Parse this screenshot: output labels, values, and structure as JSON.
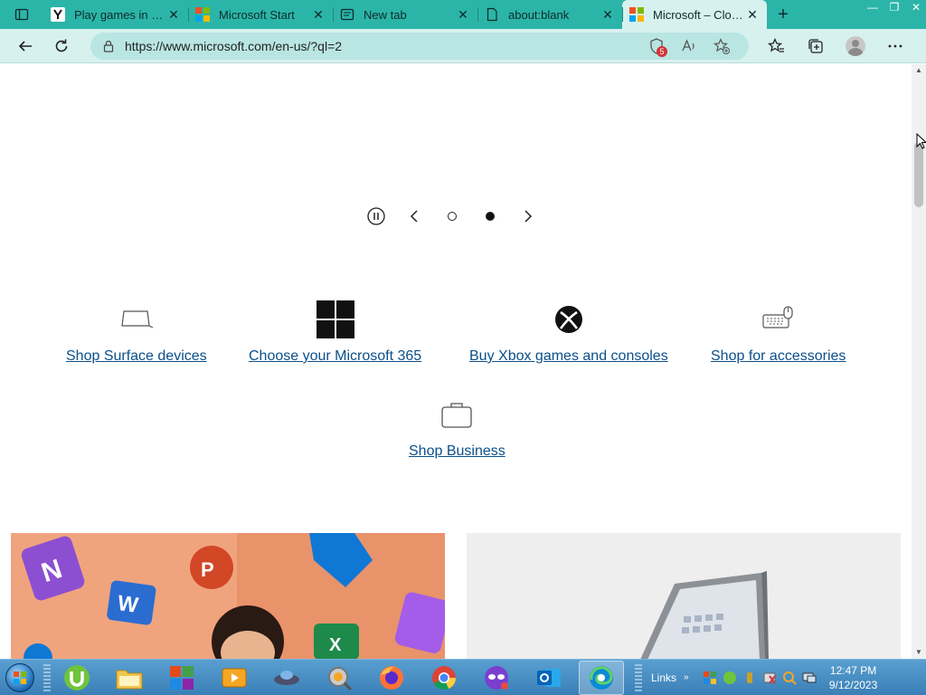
{
  "tabs": [
    {
      "title": "Play games in your browser",
      "favicon": "y-icon",
      "active": false
    },
    {
      "title": "Microsoft Start",
      "favicon": "microsoft-logo-icon",
      "active": false
    },
    {
      "title": "New tab",
      "favicon": "newtab-icon",
      "active": false
    },
    {
      "title": "about:blank",
      "favicon": "page-icon",
      "active": false
    },
    {
      "title": "Microsoft – Cloud, Computers, Apps & Gaming",
      "favicon": "microsoft-logo-icon",
      "active": true
    }
  ],
  "address": {
    "url": "https://www.microsoft.com/en-us/?ql=2",
    "tracker_badge": "5"
  },
  "shop_items": [
    {
      "label": "Shop Surface devices",
      "icon": "laptop-icon"
    },
    {
      "label": "Choose your Microsoft 365",
      "icon": "windows-logo-icon"
    },
    {
      "label": "Buy Xbox games and consoles",
      "icon": "xbox-icon"
    },
    {
      "label": "Shop for accessories",
      "icon": "keyboard-mouse-icon"
    },
    {
      "label": "Shop Business",
      "icon": "briefcase-icon"
    }
  ],
  "taskbar": {
    "links_label": "Links",
    "time": "12:47 PM",
    "date": "9/12/2023"
  },
  "colors": {
    "tabbar": "#2bb5a8",
    "link": "#0b4f8a"
  }
}
